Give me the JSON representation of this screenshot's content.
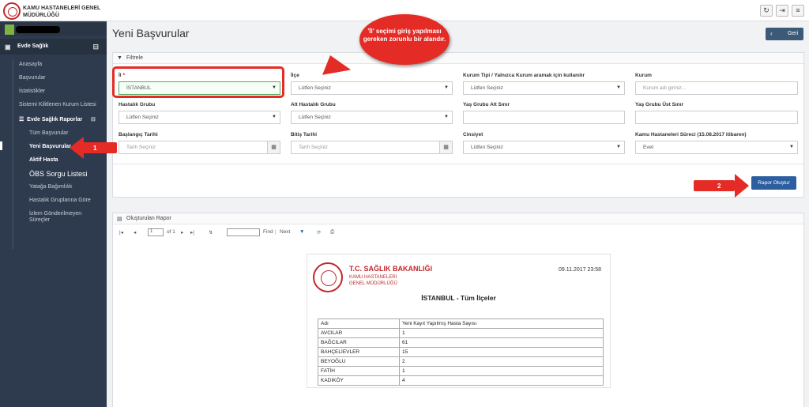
{
  "brand": {
    "line1": "KAMU HASTANELERİ GENEL",
    "line2": "MÜDÜRLÜĞÜ"
  },
  "topbar": {
    "icons": [
      "refresh-icon",
      "logout-icon",
      "menu-icon"
    ],
    "refresh_glyph": "↻",
    "logout_glyph": "⇥",
    "menu_glyph": "≡"
  },
  "sidebar": {
    "section": "Evde Sağlık",
    "toggle_glyph": "⊟",
    "items": [
      "Anasayfa",
      "Başvurular",
      "İstatistikler",
      "Sistemi Kilitlenen Kurum Listesi"
    ],
    "subsection": "Evde Sağlık Raporlar",
    "subitems": [
      "Tüm Başvurular",
      "Yeni Başvurular",
      "Aktif Hasta",
      "ÖBS Sorgu Listesi",
      "Yatağa Bağımlılık",
      "Hastalık Gruplarına Göre",
      "İzlem Gönderilmeyen Süreçler"
    ]
  },
  "page": {
    "title": "Yeni Başvurular",
    "back_label": "Geri"
  },
  "filter": {
    "title": "Filtrele",
    "fields": {
      "il": {
        "label": "İl",
        "value": "İSTANBUL"
      },
      "ilce": {
        "label": "İlçe",
        "value": "Lütfen Seçiniz"
      },
      "kurum_tipi": {
        "label": "Kurum Tipi / Yalnızca Kurum aramak için kullanılır",
        "value": "Lütfen Seçiniz"
      },
      "kurum": {
        "label": "Kurum",
        "placeholder": "Kurum adı giriniz..."
      },
      "hastalik": {
        "label": "Hastalık Grubu",
        "value": "Lütfen Seçiniz"
      },
      "alt_hastalik": {
        "label": "Alt Hastalık Grubu",
        "value": "Lütfen Seçiniz"
      },
      "yas_alt": {
        "label": "Yaş Grubu Alt Sınır",
        "value": ""
      },
      "yas_ust": {
        "label": "Yaş Grubu Üst Sınır",
        "value": ""
      },
      "baslangic": {
        "label": "Başlangıç Tarihi",
        "placeholder": "Tarih Seçiniz"
      },
      "bitis": {
        "label": "Bitiş Tarihi",
        "placeholder": "Tarih Seçiniz"
      },
      "cinsiyet": {
        "label": "Cinsiyet",
        "value": "Lütfen Seçiniz"
      },
      "surec": {
        "label": "Kamu Hastaneleri Süreci (15.08.2017 itibaren)",
        "value": "Evet"
      }
    },
    "required_mark": "*",
    "submit_label": "Rapor Oluştur"
  },
  "report_panel": {
    "title": "Oluşturulan Rapor",
    "toolbar": {
      "page": "1",
      "of_label": "of 1",
      "find_label": "Find",
      "next_label": "Next"
    },
    "paper": {
      "org_title": "T.C. SAĞLIK BAKANLIĞI",
      "org_sub1": "KAMU HASTANELERİ",
      "org_sub2": "GENEL MÜDÜRLÜĞÜ",
      "date": "09.11.2017 23:58",
      "title": "İSTANBUL - Tüm İlçeler",
      "headers": [
        "Adı",
        "Yeni Kayıt Yapılmış Hasta Sayısı"
      ],
      "rows": [
        [
          "AVCILAR",
          "1"
        ],
        [
          "BAĞCILAR",
          "61"
        ],
        [
          "BAHÇELİEVLER",
          "15"
        ],
        [
          "BEYOĞLU",
          "2"
        ],
        [
          "FATİH",
          "1"
        ],
        [
          "KADIKÖY",
          "4"
        ]
      ]
    }
  },
  "annotations": {
    "callout": "'İl' seçimi giriş yapılması gereken zorunlu bir alandır.",
    "arrow1": "1",
    "arrow2": "2",
    "color": "#e52b25"
  }
}
